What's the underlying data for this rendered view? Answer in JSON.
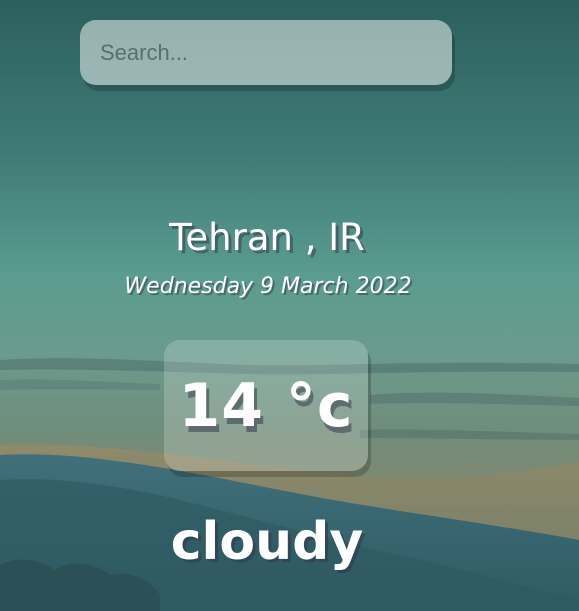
{
  "search": {
    "placeholder": "Search...",
    "value": ""
  },
  "location": {
    "text": "Tehran , IR"
  },
  "date": {
    "text": "Wednesday 9 March 2022"
  },
  "weather": {
    "temperature": "14 °c",
    "condition": "cloudy"
  },
  "colors": {
    "sky_top": "#2f6461",
    "sky_mid": "#5a9e91",
    "sky_horizon": "#6d9a8c",
    "sand": "#8c8a6e",
    "sea": "#3f6d72",
    "text": "#ffffff"
  }
}
